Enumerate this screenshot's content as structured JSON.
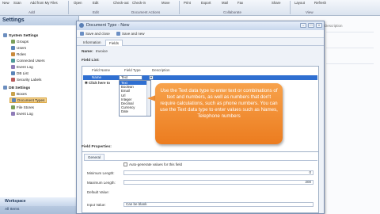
{
  "ribbon": {
    "buttons": [
      "New",
      "Scan",
      "Add from My Files",
      "Open",
      "Edit",
      "Check-out",
      "Check-in",
      "Move",
      "Print",
      "Export",
      "Mail",
      "Fax",
      "Share",
      "Layout",
      "Refresh"
    ],
    "groups": [
      "Add",
      "Edit",
      "Document Actions",
      "Collaborate",
      "View"
    ]
  },
  "sidebar": {
    "title": "Settings",
    "system_root": "System Settings",
    "system_items": [
      "Groups",
      "Users",
      "Roles",
      "Connected Users",
      "Event Log",
      "DB List",
      "Security Labels"
    ],
    "db_root": "DB Settings",
    "db_items": [
      "Boxes",
      "Document Types",
      "File Stores",
      "Event Log"
    ],
    "selected_index": 1,
    "workspace": "Workspace",
    "all_items": "All Items"
  },
  "background": {
    "header": "Description"
  },
  "dialog": {
    "title": "Document Type - New",
    "toolbar": {
      "save_close": "Save and close",
      "save_new": "Save and new"
    },
    "tabs": [
      "Information",
      "Fields"
    ],
    "active_tab": 1,
    "name_label": "Name:",
    "name_value": "Invoice",
    "field_list_label": "Field List:",
    "columns": [
      "Field Name",
      "Field Type",
      "Description"
    ],
    "selected_row": {
      "name": "Name",
      "type": "Text"
    },
    "new_row": "Click here to",
    "type_options": [
      "Text",
      "Boolean",
      "Email",
      "Url",
      "Integer",
      "Decimal",
      "Currency",
      "Date"
    ],
    "selected_option": 0,
    "field_props_label": "Field Properties:",
    "props_tab": "General",
    "props": {
      "auto_label": "Auto-generate values for this field",
      "min_label": "Minimum Length:",
      "min_value": "0",
      "max_label": "Maximum Length:",
      "max_value": "200",
      "default_label": "Default Value:",
      "input_label": "Input Value:",
      "input_value": "Can be blank"
    }
  },
  "callout": {
    "text": "Use the Text data type to enter text or combinations of text and numbers, as well as numbers that don't require calculations, such as phone numbers. You can use the Text data type to enter values such as Names, Telephone numbers"
  },
  "colors": {
    "accent": "#2f6fd1",
    "callout": "#f0913a",
    "selection": "#f5d08a"
  }
}
